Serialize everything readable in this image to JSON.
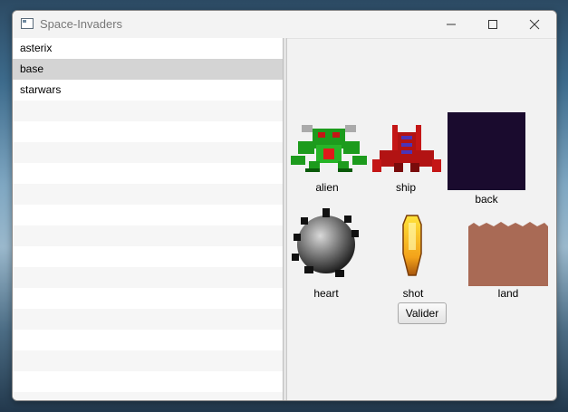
{
  "window": {
    "title": "Space-Invaders"
  },
  "list": {
    "items": [
      "asterix",
      "base",
      "starwars"
    ],
    "selected": "base"
  },
  "sprites": [
    {
      "label": "alien",
      "icon": "alien-icon"
    },
    {
      "label": "ship",
      "icon": "ship-icon"
    },
    {
      "label": "back",
      "icon": "back-tile-icon"
    },
    {
      "label": "heart",
      "icon": "heart-icon"
    },
    {
      "label": "shot",
      "icon": "shot-icon"
    },
    {
      "label": "land",
      "icon": "land-tile-icon"
    }
  ],
  "actions": {
    "validate_label": "Valider"
  },
  "colors": {
    "back_tile": "#1a0b2e",
    "land_tile": "#a96a55",
    "selection": "#d4d4d4"
  }
}
